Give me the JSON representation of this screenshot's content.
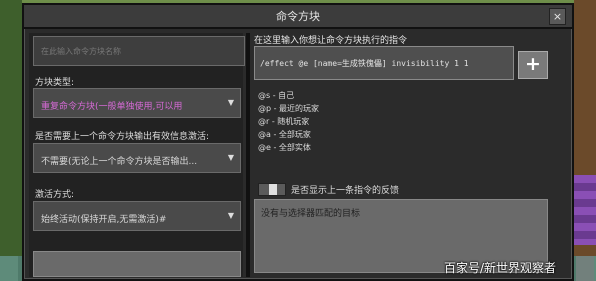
{
  "window": {
    "title": "命令方块",
    "close_label": "×"
  },
  "left": {
    "name_placeholder": "在此输入命令方块名称",
    "block_type_label": "方块类型:",
    "block_type_value": "重复命令方块(一般单独使用,可以用",
    "conditional_label": "是否需要上一个命令方块输出有效信息激活:",
    "conditional_value": "不需要(无论上一个命令方块是否输出...",
    "activation_label": "激活方式:",
    "activation_value": "始终活动(保持开启,无需激活)#"
  },
  "right": {
    "prompt": "在这里输入你想让命令方块执行的指令",
    "command_value": "/effect @e [name=生成铁傀儡] invisibility 1 1",
    "add_label": "+",
    "selectors": [
      "@s - 自己",
      "@p - 最近的玩家",
      "@r - 随机玩家",
      "@a - 全部玩家",
      "@e - 全部实体"
    ],
    "toggle_label": "是否显示上一条指令的反馈",
    "output_text": "没有与选择器匹配的目标"
  },
  "watermark": "百家号/新世界观察者",
  "colors": {
    "window_bg": "#2b2b2b",
    "block_type_text": "#d66ad6",
    "output_bg": "#6a6a6a"
  }
}
